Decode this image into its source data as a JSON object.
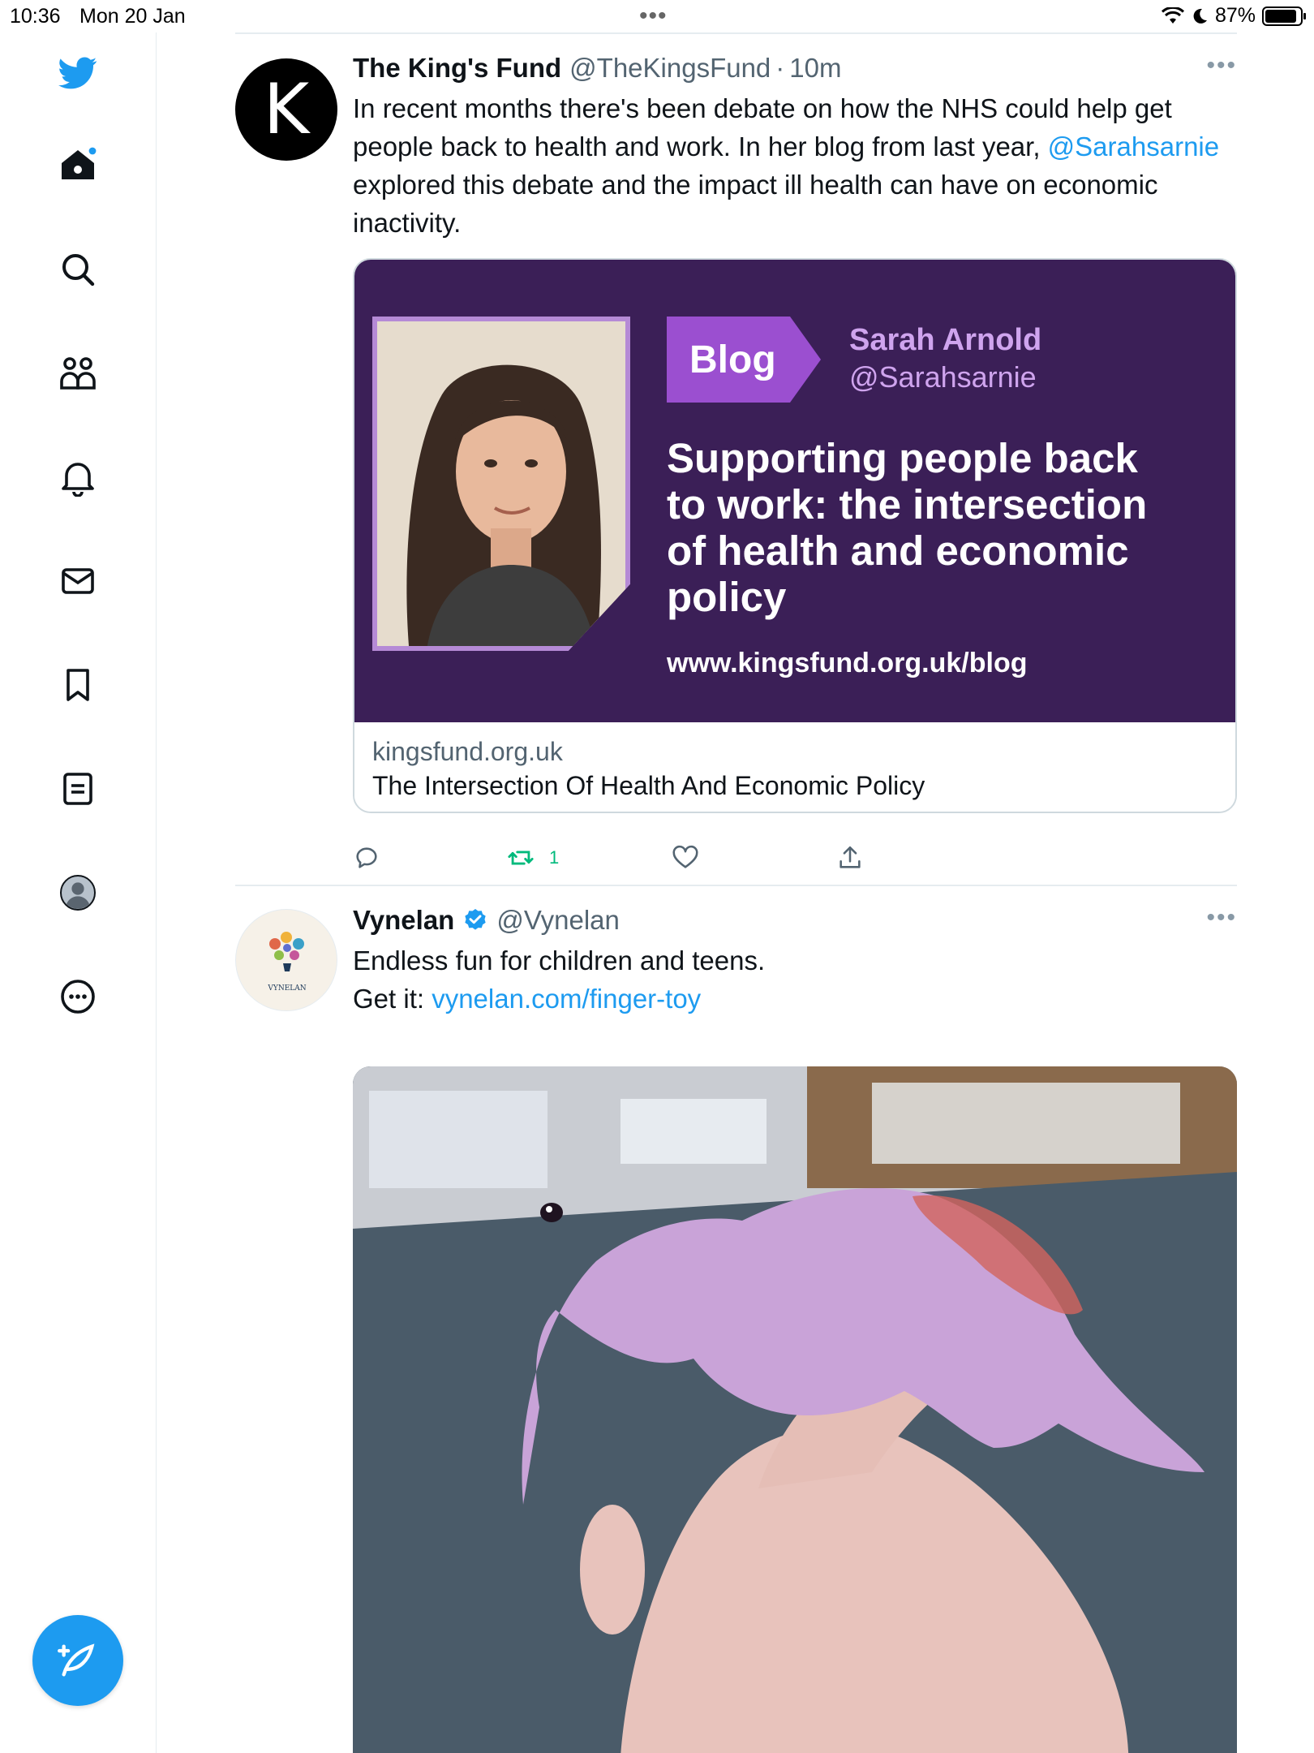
{
  "status_bar": {
    "time": "10:36",
    "date": "Mon 20 Jan",
    "battery": "87%",
    "battery_level": 0.87
  },
  "sidebar": {
    "items": [
      {
        "icon": "twitter-logo-icon"
      },
      {
        "icon": "home-icon"
      },
      {
        "icon": "search-icon"
      },
      {
        "icon": "communities-icon"
      },
      {
        "icon": "notifications-icon"
      },
      {
        "icon": "messages-icon"
      },
      {
        "icon": "bookmarks-icon"
      },
      {
        "icon": "lists-icon"
      },
      {
        "icon": "profile-icon"
      },
      {
        "icon": "more-icon"
      }
    ],
    "compose_icon": "compose-tweet-icon",
    "accent": "#1d9bf0"
  },
  "tweets": [
    {
      "name": "The King's Fund",
      "handle": "@TheKingsFund",
      "time": "10m",
      "avatar_letter": "K",
      "text_before": "In recent months there's been debate on how the NHS could help get people back to health and work. In her blog from last year, ",
      "mention": "@Sarahsarnie",
      "text_after": " explored this debate and the impact ill health can have on economic inactivity.",
      "card": {
        "badge": "Blog",
        "author_name": "Sarah Arnold",
        "author_handle": "@Sarahsarnie",
        "headline": "Supporting people back to work: the intersection of health and economic policy",
        "url": "www.kingsfund.org.uk/blog",
        "domain": "kingsfund.org.uk",
        "title": "The Intersection Of Health And Economic Policy"
      },
      "retweet_count": "1"
    },
    {
      "name": "Vynelan",
      "handle": "@Vynelan",
      "verified": true,
      "avatar_text": "VYNELAN",
      "line1": "Endless fun for children and teens.",
      "line2_prefix": "Get it: ",
      "line2_link": "vynelan.com/finger-toy"
    }
  ]
}
